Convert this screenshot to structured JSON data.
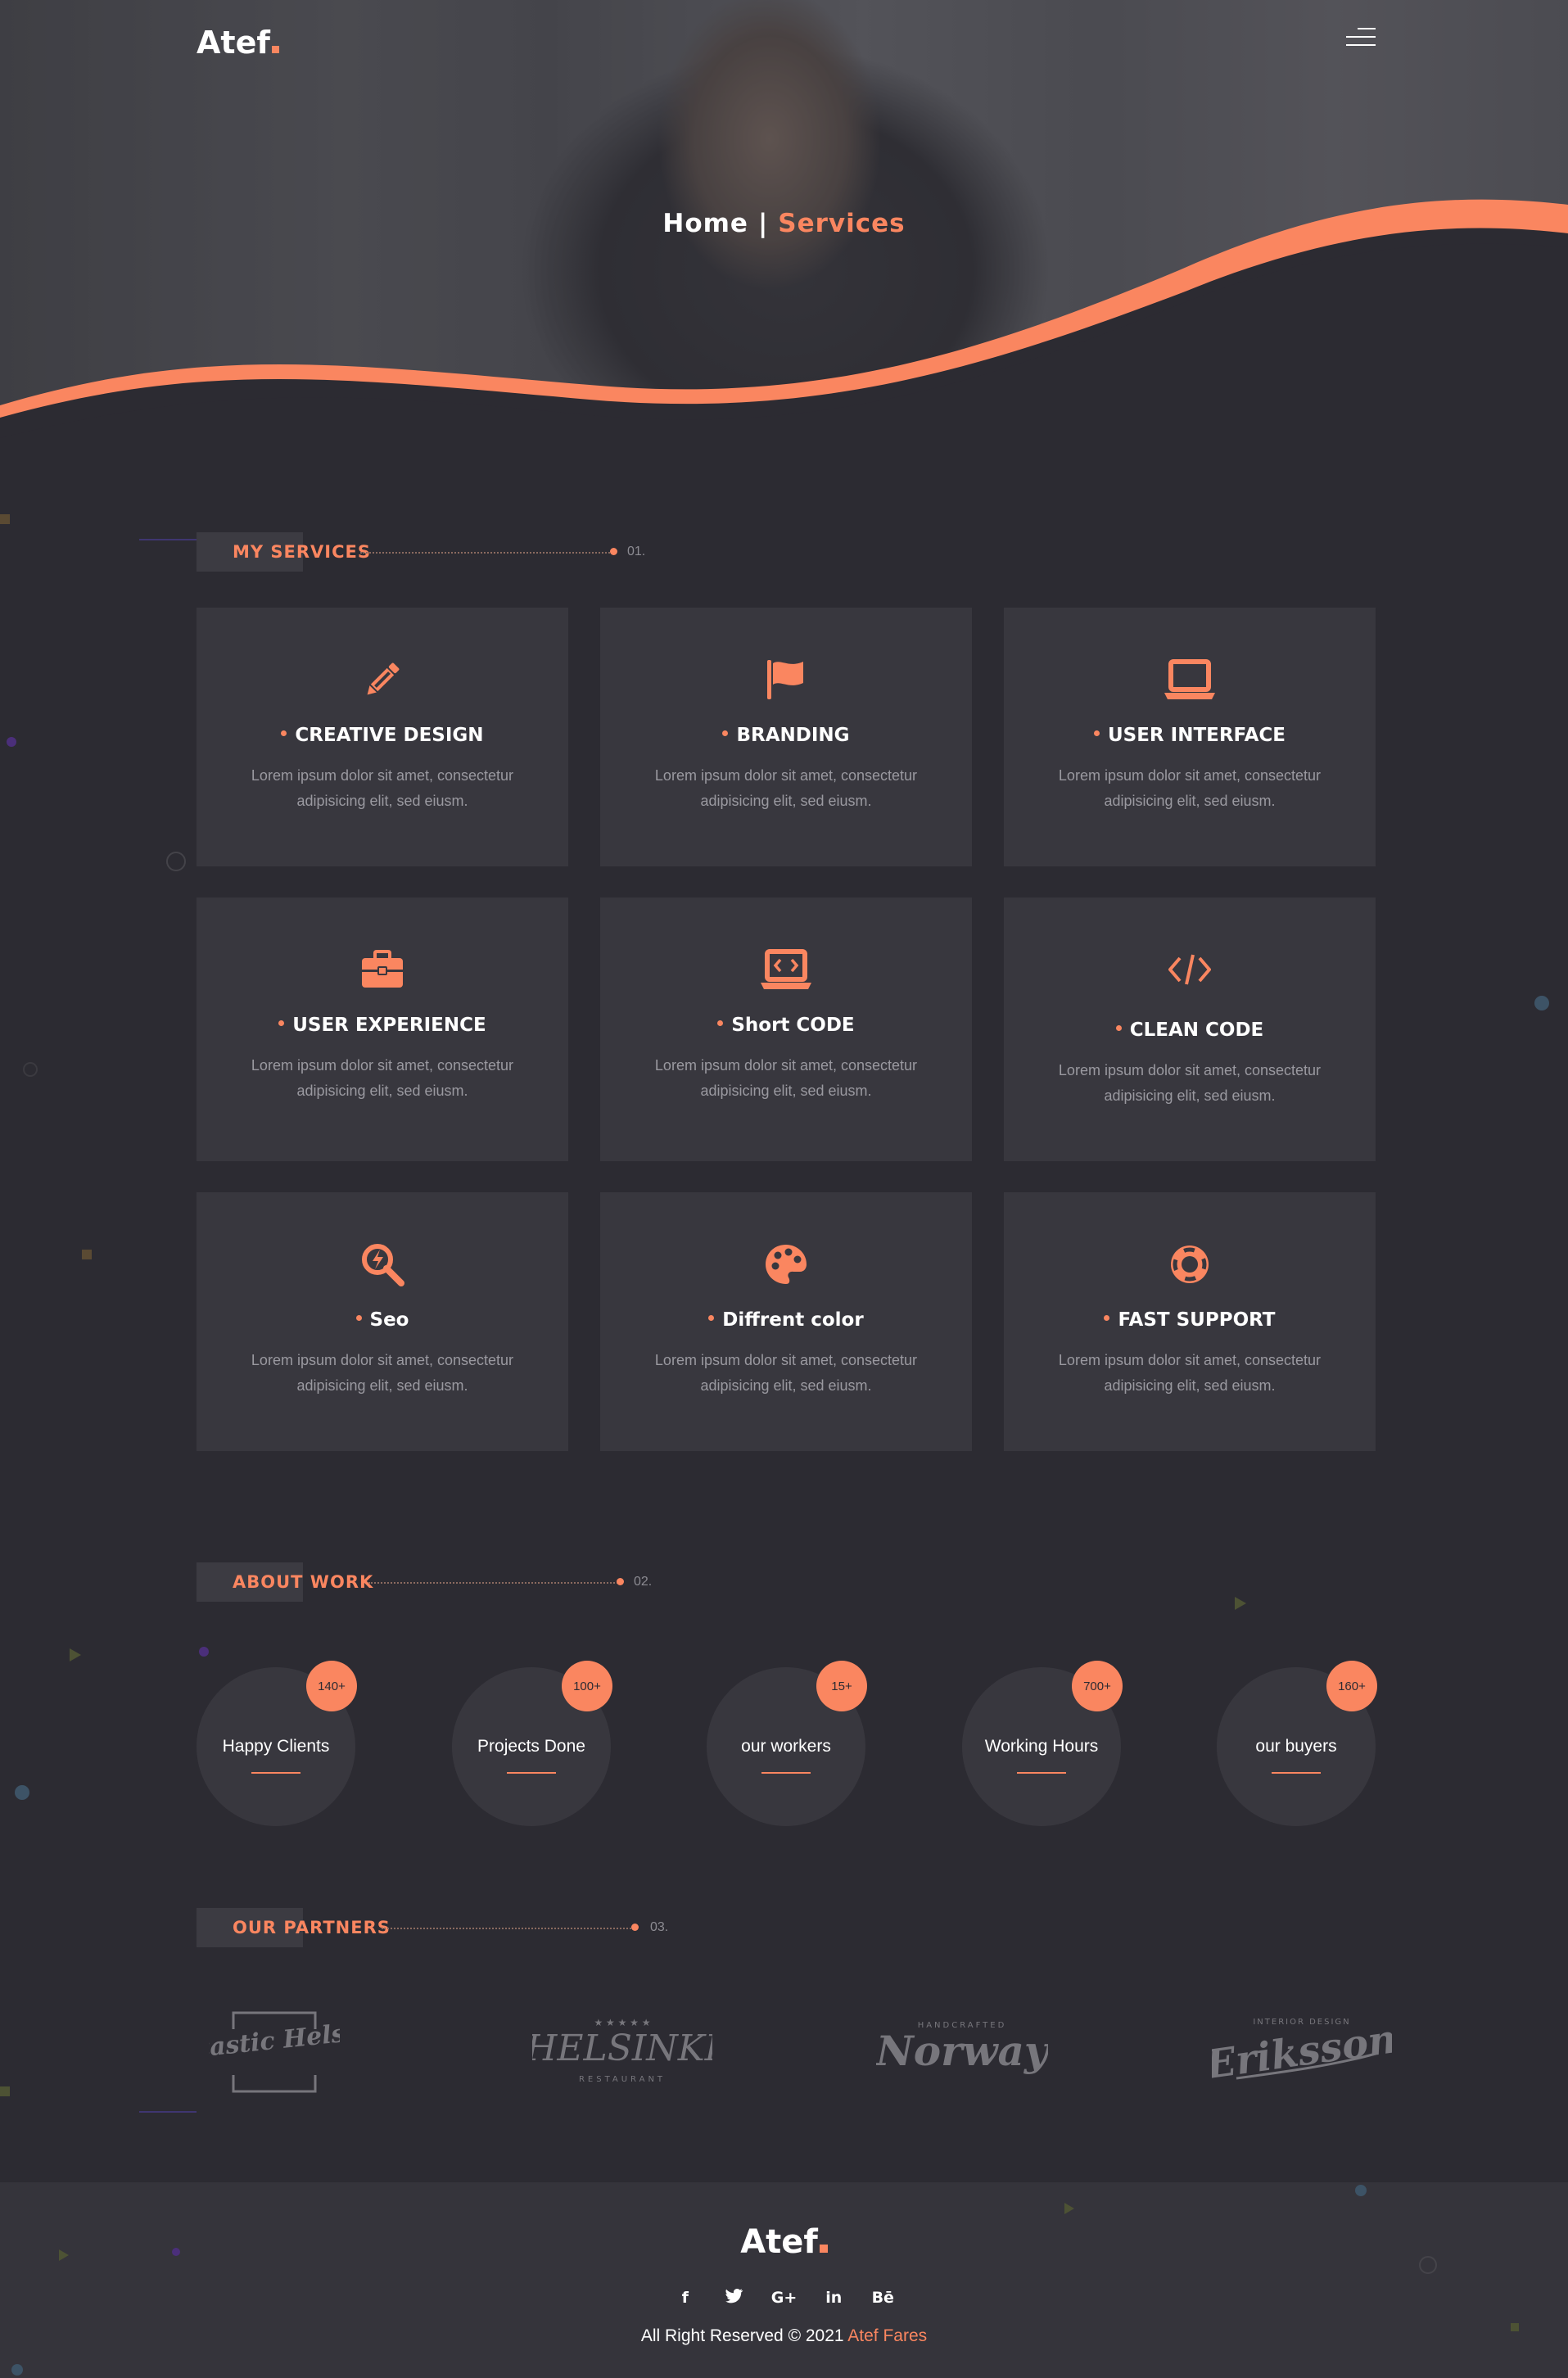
{
  "brand": {
    "logo_text": "Atef",
    "accent": "#fa8660",
    "background": "#2c2b32",
    "card_bg": "#38373e"
  },
  "header": {
    "menu_icon": "hamburger-menu-icon"
  },
  "breadcrumb": {
    "home": "Home",
    "separator": "|",
    "current": "Services"
  },
  "services_section": {
    "title": "MY SERVICES",
    "number": "01.",
    "cards": [
      {
        "icon": "pencil-icon",
        "title": "CREATIVE DESIGN",
        "desc": "Lorem ipsum dolor sit amet, consectetur adipisicing elit, sed eiusm."
      },
      {
        "icon": "flag-icon",
        "title": "BRANDING",
        "desc": "Lorem ipsum dolor sit amet, consectetur adipisicing elit, sed eiusm."
      },
      {
        "icon": "laptop-icon",
        "title": "USER INTERFACE",
        "desc": "Lorem ipsum dolor sit amet, consectetur adipisicing elit, sed eiusm."
      },
      {
        "icon": "briefcase-icon",
        "title": "USER EXPERIENCE",
        "desc": "Lorem ipsum dolor sit amet, consectetur adipisicing elit, sed eiusm."
      },
      {
        "icon": "laptop-code-icon",
        "title": "Short CODE",
        "desc": "Lorem ipsum dolor sit amet, consectetur adipisicing elit, sed eiusm."
      },
      {
        "icon": "code-icon",
        "title": "CLEAN CODE",
        "desc": "Lorem ipsum dolor sit amet, consectetur adipisicing elit, sed eiusm."
      },
      {
        "icon": "search-bolt-icon",
        "title": "Seo",
        "desc": "Lorem ipsum dolor sit amet, consectetur adipisicing elit, sed eiusm."
      },
      {
        "icon": "palette-icon",
        "title": "Diffrent color",
        "desc": "Lorem ipsum dolor sit amet, consectetur adipisicing elit, sed eiusm."
      },
      {
        "icon": "lifebuoy-icon",
        "title": "FAST SUPPORT",
        "desc": "Lorem ipsum dolor sit amet, consectetur adipisicing elit, sed eiusm."
      }
    ]
  },
  "about_section": {
    "title": "ABOUT WORK",
    "number": "02.",
    "counters": [
      {
        "value": "140+",
        "label": "Happy Clients"
      },
      {
        "value": "100+",
        "label": "Projects Done"
      },
      {
        "value": "15+",
        "label": "our workers"
      },
      {
        "value": "700+",
        "label": "Working Hours"
      },
      {
        "value": "160+",
        "label": "our buyers"
      }
    ]
  },
  "partners_section": {
    "title": "OUR PARTNERS",
    "number": "03.",
    "logos": [
      {
        "name": "Fantastic Helsinki"
      },
      {
        "name": "HELSINKI",
        "sub": "RESTAURANT"
      },
      {
        "name": "Norway",
        "top": "HANDCRAFTED"
      },
      {
        "name": "Eriksson",
        "top": "INTERIOR DESIGN"
      }
    ]
  },
  "footer": {
    "logo_text": "Atef",
    "socials": [
      "f",
      "t",
      "G+",
      "in",
      "Bē"
    ],
    "copyright": "All Right Reserved © 2021",
    "author": "Atef Fares"
  }
}
